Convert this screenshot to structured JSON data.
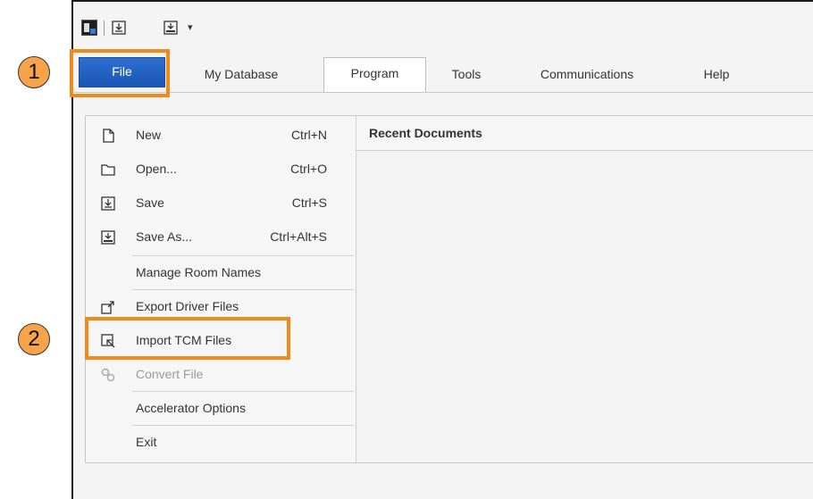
{
  "quick_access": {
    "icons": [
      "app-logo-icon",
      "save-icon",
      "save-as-icon",
      "customize-dropdown-icon"
    ],
    "dropdown_glyph": "▾"
  },
  "tabs": [
    {
      "label": "File",
      "active": true
    },
    {
      "label": "My Database"
    },
    {
      "label": "Program",
      "selected": true
    },
    {
      "label": "Tools"
    },
    {
      "label": "Communications"
    },
    {
      "label": "Help"
    }
  ],
  "file_menu": {
    "items": [
      {
        "label": "New",
        "shortcut": "Ctrl+N",
        "icon": "new-document-icon"
      },
      {
        "label": "Open...",
        "shortcut": "Ctrl+O",
        "icon": "folder-icon"
      },
      {
        "label": "Save",
        "shortcut": "Ctrl+S",
        "icon": "save-icon"
      },
      {
        "label": "Save As...",
        "shortcut": "Ctrl+Alt+S",
        "icon": "save-as-icon"
      },
      {
        "label": "Manage Room Names"
      },
      {
        "label": "Export Driver Files",
        "icon": "export-icon"
      },
      {
        "label": "Import TCM Files",
        "icon": "import-icon"
      },
      {
        "label": "Convert File",
        "icon": "convert-link-icon",
        "disabled": true
      },
      {
        "label": "Accelerator Options"
      },
      {
        "label": "Exit"
      }
    ]
  },
  "recent": {
    "heading": "Recent Documents"
  },
  "callouts": {
    "step1": "1",
    "step2": "2"
  },
  "colors": {
    "file_tab": "#1a56b4",
    "highlight": "#f08a1c",
    "callout_fill": "#f7a34a"
  }
}
